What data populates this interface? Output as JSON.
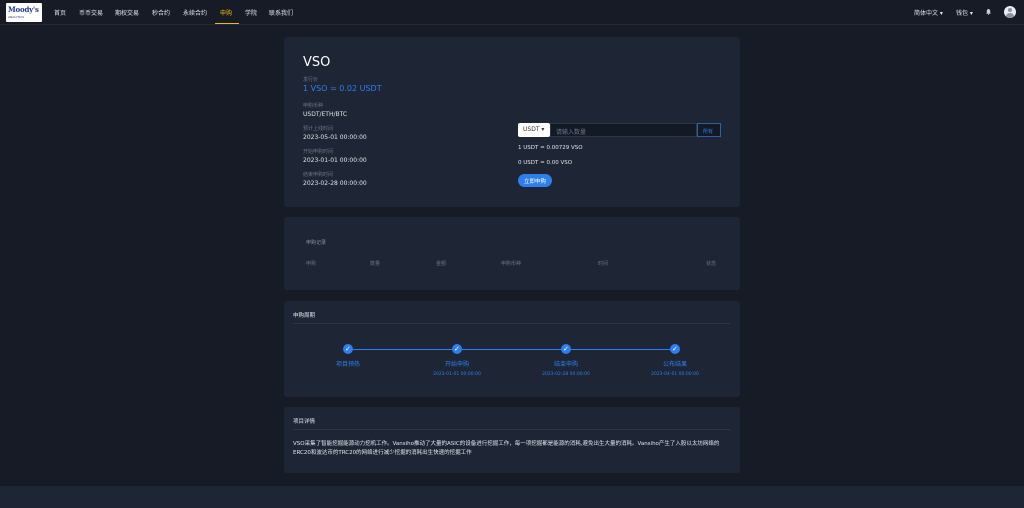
{
  "logo": {
    "line1": "Moody's",
    "line2": "ANALYTICS"
  },
  "nav": {
    "items": [
      "首页",
      "币币交易",
      "期权交易",
      "秒合约",
      "永续合约",
      "申购",
      "学院",
      "联系我们"
    ],
    "active": "申购",
    "language": "简体中文 ▾",
    "wallet": "钱包 ▾"
  },
  "token": {
    "name": "VSO",
    "price_label": "发行价",
    "price_value": "1 VSO = 0.02 USDT",
    "currency_label": "申购币种",
    "currency_value": "USDT/ETH/BTC",
    "listing_label": "预计上线时间",
    "listing_value": "2023-05-01 00:00:00",
    "start_label": "开始申购时间",
    "start_value": "2023-01-01 00:00:00",
    "end_label": "结束申购时间",
    "end_value": "2023-02-28 00:00:00"
  },
  "form": {
    "selected_currency": "USDT ▾",
    "amount_placeholder": "请输入数量",
    "all_label": "所有",
    "rate_line": "1 USDT = 0.00729 VSO",
    "result_line": "0 USDT = 0.00 VSO",
    "submit_label": "立即申购"
  },
  "records": {
    "title": "申购记录",
    "columns": [
      "申购",
      "数量",
      "金额",
      "申购币种",
      "时间",
      "状态"
    ]
  },
  "schedule": {
    "title": "申购周期",
    "steps": [
      {
        "label": "项目预热",
        "date": ""
      },
      {
        "label": "开始申购",
        "date": "2023-01-01 00:00:00"
      },
      {
        "label": "结束申购",
        "date": "2023-02-28 00:00:00"
      },
      {
        "label": "公布结果",
        "date": "2023-04-01 00:00:00"
      }
    ]
  },
  "details": {
    "title": "项目详情",
    "text": "VSO采集了智能挖掘能源动力挖机工作。Vansiho推动了大量的ASIC的设备进行挖掘工作，每一项挖掘都是能源的消耗,避免出生大量的消耗。Vansiho产生了入股以太坊网络的ERC20和波达币的TRC20的网络进行减少挖掘的消耗出生快速的挖掘工作"
  },
  "colors": {
    "accent": "#2d7ff0",
    "active_nav": "#f0b90b",
    "card": "#1e2534",
    "background": "#161b26"
  }
}
